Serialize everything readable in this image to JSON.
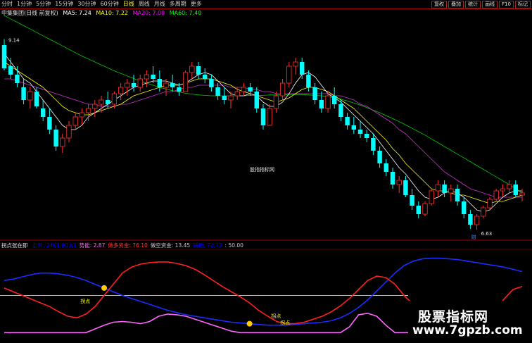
{
  "toolbar": {
    "periods": [
      "分时",
      "1分钟",
      "5分钟",
      "15分钟",
      "30分钟",
      "60分钟",
      "日线",
      "周线",
      "月线",
      "多周期",
      "更多"
    ],
    "active_period": "日线",
    "tools": [
      "复权",
      "叠加",
      "统计",
      "画线",
      "F10",
      "标记"
    ]
  },
  "main_legend": {
    "title": "中集集团(日线 前复权)",
    "ma5_label": "MA5: 7.24",
    "ma10_label": "MA10: 7.22",
    "ma20_label": "MA20: 7.09",
    "ma60_label": "MA60: 7.40",
    "colors": {
      "ma5": "#ffffff",
      "ma10": "#ffff00",
      "ma20": "#ff00ff",
      "ma60": "#00ff00",
      "up": "#ff3232",
      "down": "#00ffff"
    }
  },
  "annotations": {
    "high_label": "9.14",
    "low_label": "6.63",
    "watermark_small": "股指指标网",
    "cai_mark": "财"
  },
  "sub_legend": {
    "name": "拐点张在即",
    "items": [
      {
        "text": "走势: 2461 90.61",
        "color": "#0000ff"
      },
      {
        "text": "势能: 2.87",
        "color": "#ff66ff"
      },
      {
        "text": "做多资金: 76.10",
        "color": "#ff3333"
      },
      {
        "text": "做空资金: 13.45",
        "color": "#c8c8c8"
      },
      {
        "text": "辅助: 72.73",
        "color": "#0000ff"
      },
      {
        "text": ": 50.00",
        "color": "#c8c8c8"
      }
    ],
    "turn_labels": [
      "拐点",
      "拐点",
      "拐点"
    ]
  },
  "watermark": {
    "line1": "股票指标网",
    "line2": "www.7gpzb.com"
  },
  "chart_data": {
    "type": "candlestick",
    "candles": [
      [
        9.0,
        9.14,
        8.4,
        8.45
      ],
      [
        8.5,
        8.7,
        8.2,
        8.3
      ],
      [
        8.3,
        8.5,
        8.0,
        8.1
      ],
      [
        8.0,
        8.2,
        7.6,
        7.7
      ],
      [
        7.7,
        8.0,
        7.5,
        7.9
      ],
      [
        7.9,
        8.0,
        7.5,
        7.55
      ],
      [
        7.5,
        7.7,
        7.2,
        7.3
      ],
      [
        7.3,
        7.5,
        6.9,
        7.0
      ],
      [
        7.0,
        7.1,
        6.5,
        6.6
      ],
      [
        6.6,
        6.9,
        6.45,
        6.8
      ],
      [
        6.8,
        7.2,
        6.7,
        7.1
      ],
      [
        7.1,
        7.4,
        7.0,
        7.3
      ],
      [
        7.3,
        7.5,
        7.1,
        7.4
      ],
      [
        7.4,
        7.6,
        7.2,
        7.5
      ],
      [
        7.5,
        7.7,
        7.3,
        7.6
      ],
      [
        7.6,
        7.8,
        7.4,
        7.7
      ],
      [
        7.7,
        7.9,
        7.5,
        7.6
      ],
      [
        7.6,
        7.9,
        7.5,
        7.85
      ],
      [
        7.85,
        8.1,
        7.7,
        8.0
      ],
      [
        8.0,
        8.2,
        7.8,
        8.1
      ],
      [
        8.1,
        8.3,
        7.9,
        8.0
      ],
      [
        8.0,
        8.3,
        7.9,
        8.2
      ],
      [
        8.2,
        8.4,
        8.0,
        8.3
      ],
      [
        8.3,
        8.5,
        8.1,
        8.2
      ],
      [
        8.2,
        8.4,
        7.9,
        8.0
      ],
      [
        8.0,
        8.2,
        7.8,
        8.1
      ],
      [
        8.1,
        8.3,
        7.9,
        8.0
      ],
      [
        8.0,
        8.1,
        7.8,
        7.9
      ],
      [
        7.9,
        8.4,
        7.9,
        8.35
      ],
      [
        8.35,
        8.6,
        8.2,
        8.5
      ],
      [
        8.5,
        8.6,
        8.2,
        8.3
      ],
      [
        8.3,
        8.45,
        8.1,
        8.2
      ],
      [
        8.2,
        8.3,
        7.9,
        8.0
      ],
      [
        8.0,
        8.1,
        7.7,
        7.8
      ],
      [
        7.8,
        8.0,
        7.6,
        7.7
      ],
      [
        7.7,
        7.9,
        7.5,
        7.8
      ],
      [
        7.8,
        8.0,
        7.7,
        7.9
      ],
      [
        7.9,
        8.1,
        7.8,
        8.0
      ],
      [
        8.0,
        8.1,
        7.8,
        7.9
      ],
      [
        7.9,
        8.0,
        7.4,
        7.5
      ],
      [
        7.5,
        7.6,
        7.0,
        7.1
      ],
      [
        7.1,
        7.6,
        7.1,
        7.5
      ],
      [
        7.5,
        7.9,
        7.4,
        7.8
      ],
      [
        7.8,
        8.2,
        7.7,
        8.1
      ],
      [
        8.1,
        8.6,
        8.0,
        8.5
      ],
      [
        8.5,
        8.7,
        8.3,
        8.6
      ],
      [
        8.6,
        8.7,
        8.2,
        8.3
      ],
      [
        8.3,
        8.4,
        7.9,
        8.0
      ],
      [
        8.0,
        8.1,
        7.6,
        7.7
      ],
      [
        7.7,
        7.9,
        7.4,
        7.5
      ],
      [
        7.5,
        7.9,
        7.4,
        7.8
      ],
      [
        7.8,
        8.0,
        7.5,
        7.6
      ],
      [
        7.6,
        7.7,
        7.2,
        7.3
      ],
      [
        7.3,
        7.4,
        7.0,
        7.1
      ],
      [
        7.1,
        7.3,
        6.9,
        7.0
      ],
      [
        7.0,
        7.2,
        6.8,
        6.9
      ],
      [
        6.9,
        7.0,
        6.7,
        6.8
      ],
      [
        6.8,
        6.9,
        6.4,
        6.5
      ],
      [
        6.5,
        6.6,
        6.1,
        6.2
      ],
      [
        6.2,
        6.3,
        5.9,
        6.0
      ],
      [
        6.0,
        6.1,
        5.6,
        5.7
      ],
      [
        5.7,
        5.9,
        5.5,
        5.8
      ],
      [
        5.8,
        5.9,
        5.4,
        5.45
      ],
      [
        5.45,
        5.6,
        5.1,
        5.2
      ],
      [
        5.2,
        5.3,
        4.9,
        5.0
      ],
      [
        5.0,
        5.3,
        4.95,
        5.25
      ],
      [
        5.25,
        5.6,
        5.2,
        5.55
      ],
      [
        5.55,
        5.8,
        5.4,
        5.7
      ],
      [
        5.7,
        5.8,
        5.4,
        5.5
      ],
      [
        5.5,
        5.7,
        5.3,
        5.6
      ],
      [
        5.6,
        5.7,
        5.2,
        5.3
      ],
      [
        5.3,
        5.4,
        4.9,
        5.0
      ],
      [
        5.0,
        5.1,
        4.65,
        4.75
      ],
      [
        4.75,
        5.0,
        4.63,
        4.95
      ],
      [
        4.95,
        5.2,
        4.9,
        5.15
      ],
      [
        5.15,
        5.4,
        5.1,
        5.35
      ],
      [
        5.35,
        5.6,
        5.3,
        5.55
      ],
      [
        5.55,
        5.7,
        5.4,
        5.6
      ],
      [
        5.6,
        5.8,
        5.5,
        5.7
      ],
      [
        5.7,
        5.8,
        5.4,
        5.45
      ],
      [
        5.45,
        5.6,
        5.3,
        5.5
      ]
    ],
    "ma5": [
      8.8,
      8.6,
      8.4,
      8.2,
      8.1,
      7.9,
      7.7,
      7.5,
      7.3,
      7.1,
      7.0,
      7.0,
      7.1,
      7.3,
      7.4,
      7.5,
      7.6,
      7.7,
      7.8,
      7.9,
      8.0,
      8.05,
      8.1,
      8.15,
      8.15,
      8.15,
      8.1,
      8.05,
      8.1,
      8.2,
      8.3,
      8.35,
      8.3,
      8.15,
      8.0,
      7.85,
      7.8,
      7.8,
      7.85,
      7.8,
      7.65,
      7.55,
      7.55,
      7.65,
      7.85,
      8.1,
      8.3,
      8.35,
      8.25,
      8.05,
      7.85,
      7.75,
      7.65,
      7.5,
      7.35,
      7.2,
      7.05,
      6.9,
      6.7,
      6.5,
      6.3,
      6.1,
      5.95,
      5.75,
      5.55,
      5.4,
      5.35,
      5.4,
      5.5,
      5.55,
      5.5,
      5.4,
      5.25,
      5.1,
      5.05,
      5.1,
      5.25,
      5.4,
      5.5,
      5.55,
      5.55
    ],
    "ma10": [
      8.6,
      8.5,
      8.4,
      8.3,
      8.2,
      8.1,
      8.0,
      7.85,
      7.7,
      7.55,
      7.45,
      7.4,
      7.35,
      7.35,
      7.4,
      7.45,
      7.5,
      7.55,
      7.6,
      7.7,
      7.8,
      7.85,
      7.9,
      7.95,
      8.0,
      8.05,
      8.05,
      8.05,
      8.1,
      8.15,
      8.2,
      8.2,
      8.2,
      8.15,
      8.1,
      8.05,
      7.95,
      7.9,
      7.85,
      7.8,
      7.75,
      7.7,
      7.65,
      7.7,
      7.75,
      7.85,
      7.95,
      8.0,
      8.0,
      7.95,
      7.9,
      7.8,
      7.7,
      7.6,
      7.5,
      7.35,
      7.2,
      7.05,
      6.9,
      6.75,
      6.55,
      6.4,
      6.2,
      6.05,
      5.9,
      5.75,
      5.6,
      5.55,
      5.55,
      5.5,
      5.45,
      5.45,
      5.4,
      5.35,
      5.3,
      5.25,
      5.3,
      5.3,
      5.35,
      5.4,
      5.45
    ],
    "ma20": [
      8.2,
      8.2,
      8.15,
      8.1,
      8.05,
      8.0,
      7.95,
      7.9,
      7.85,
      7.8,
      7.75,
      7.7,
      7.65,
      7.6,
      7.6,
      7.55,
      7.55,
      7.55,
      7.6,
      7.6,
      7.65,
      7.7,
      7.75,
      7.8,
      7.85,
      7.9,
      7.9,
      7.95,
      8.0,
      8.0,
      8.05,
      8.05,
      8.05,
      8.05,
      8.05,
      8.0,
      8.0,
      8.0,
      7.95,
      7.95,
      7.9,
      7.9,
      7.85,
      7.85,
      7.85,
      7.85,
      7.85,
      7.85,
      7.85,
      7.85,
      7.85,
      7.8,
      7.8,
      7.75,
      7.7,
      7.6,
      7.55,
      7.45,
      7.35,
      7.25,
      7.15,
      7.0,
      6.9,
      6.75,
      6.6,
      6.45,
      6.3,
      6.15,
      6.0,
      5.9,
      5.8,
      5.7,
      5.6,
      5.55,
      5.5,
      5.45,
      5.4,
      5.4,
      5.4,
      5.4,
      5.4
    ],
    "ma60": [
      9.7,
      9.62,
      9.54,
      9.46,
      9.38,
      9.3,
      9.22,
      9.14,
      9.06,
      8.98,
      8.9,
      8.82,
      8.74,
      8.67,
      8.6,
      8.53,
      8.46,
      8.39,
      8.33,
      8.27,
      8.21,
      8.15,
      8.1,
      8.05,
      8.0,
      7.96,
      7.92,
      7.89,
      7.86,
      7.84,
      7.82,
      7.81,
      7.8,
      7.8,
      7.8,
      7.8,
      7.8,
      7.8,
      7.81,
      7.81,
      7.81,
      7.82,
      7.82,
      7.82,
      7.83,
      7.83,
      7.83,
      7.82,
      7.81,
      7.8,
      7.78,
      7.75,
      7.72,
      7.68,
      7.63,
      7.58,
      7.52,
      7.46,
      7.4,
      7.33,
      7.26,
      7.19,
      7.11,
      7.03,
      6.95,
      6.87,
      6.78,
      6.69,
      6.6,
      6.51,
      6.42,
      6.33,
      6.24,
      6.15,
      6.06,
      5.97,
      5.88,
      5.79,
      5.7,
      5.6,
      5.5
    ],
    "indicator": {
      "ref_line": 50,
      "blue": [
        70,
        72,
        75,
        78,
        80,
        80,
        79,
        77,
        74,
        70,
        65,
        60,
        55,
        50,
        46,
        42,
        38,
        34,
        30,
        27,
        24,
        22,
        20,
        18,
        16,
        14,
        13,
        12,
        11,
        10,
        10,
        10,
        11,
        12,
        13,
        14,
        16,
        20,
        26,
        34,
        44,
        56,
        68,
        80,
        90,
        96,
        99,
        100,
        100,
        99,
        98,
        96,
        94,
        92,
        90,
        88,
        85,
        82
      ],
      "red": [
        60,
        55,
        50,
        45,
        40,
        35,
        28,
        22,
        20,
        25,
        35,
        50,
        65,
        80,
        88,
        92,
        94,
        95,
        95,
        93,
        90,
        85,
        78,
        70,
        62,
        55,
        48,
        40,
        30,
        22,
        15,
        12,
        12,
        14,
        18,
        22,
        28,
        36,
        46,
        58,
        70,
        76,
        74,
        65,
        50,
        38,
        28,
        20,
        15,
        12,
        10,
        8,
        12,
        20,
        30,
        45,
        58,
        62
      ],
      "pink": [
        0,
        0,
        0,
        0,
        0,
        0,
        0,
        0,
        0,
        0,
        5,
        10,
        14,
        15,
        14,
        12,
        15,
        22,
        25,
        24,
        22,
        18,
        14,
        10,
        6,
        2,
        0,
        0,
        0,
        0,
        0,
        0,
        0,
        0,
        0,
        0,
        0,
        0,
        8,
        24,
        26,
        22,
        10,
        0,
        0,
        0,
        0,
        0,
        0,
        0,
        0,
        0,
        0,
        0,
        0,
        0,
        0,
        0
      ]
    }
  }
}
